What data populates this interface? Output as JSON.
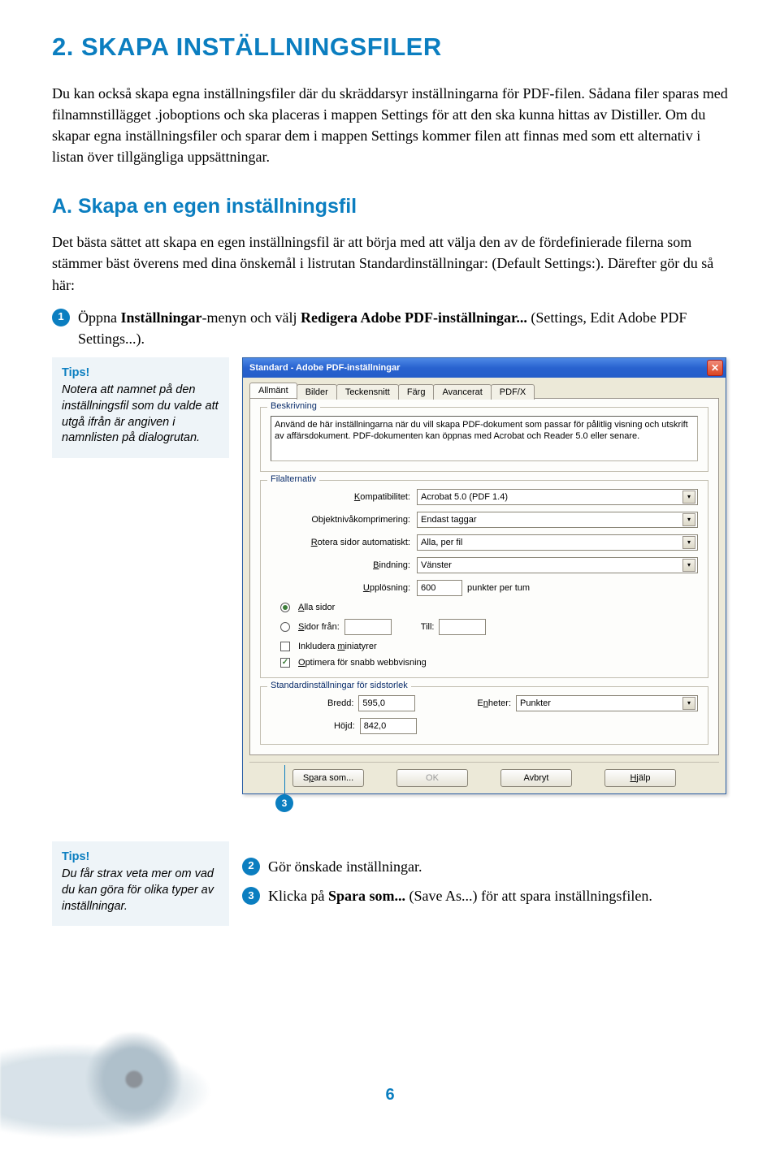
{
  "chapter_title": "2. SKAPA INSTÄLLNINGSFILER",
  "intro": "Du kan också skapa egna inställningsfiler där du skräddarsyr inställningarna för PDF-filen. Sådana filer sparas med filnamnstillägget .joboptions och ska placeras i mappen Settings för att den ska kunna hittas av Distiller. Om du skapar egna inställningsfiler och sparar dem i mappen Settings kommer filen att finnas med som ett alternativ i listan över tillgängliga uppsättningar.",
  "section_a_title": "A. Skapa en egen inställningsfil",
  "section_a_body": "Det bästa sättet att skapa en egen inställningsfil är att börja med att välja den av de fördefinierade filerna som stämmer bäst överens med dina önskemål i listrutan Standardinställningar: (Default Settings:). Därefter gör du så här:",
  "steps": {
    "s1_a": "Öppna ",
    "s1_b": "Inställningar",
    "s1_c": "-menyn och välj ",
    "s1_d": "Redigera Adobe PDF-inställningar...",
    "s1_e": " (Settings, Edit Adobe PDF Settings...).",
    "s2": "Gör önskade inställningar.",
    "s3_a": "Klicka på ",
    "s3_b": "Spara som...",
    "s3_c": " (Save As...) för att spara inställningsfilen."
  },
  "tips1": {
    "title": "Tips!",
    "body": "Notera att namnet på den inställningsfil som du valde att utgå ifrån är angiven i namnlisten på dialogrutan."
  },
  "tips2": {
    "title": "Tips!",
    "body": "Du får strax veta mer om vad du kan göra för olika typer av inställningar."
  },
  "dialog": {
    "title": "Standard - Adobe PDF-inställningar",
    "tabs": [
      "Allmänt",
      "Bilder",
      "Teckensnitt",
      "Färg",
      "Avancerat",
      "PDF/X"
    ],
    "group_desc": "Beskrivning",
    "desc_text": "Använd de här inställningarna när du vill skapa PDF-dokument som passar för pålitlig visning och utskrift av affärsdokument. PDF-dokumenten kan öppnas med Acrobat och Reader 5.0 eller senare.",
    "group_file": "Filalternativ",
    "labels": {
      "compat": "Kompatibilitet:",
      "objcomp": "Objektnivåkomprimering:",
      "rotate": "Rotera sidor automatiskt:",
      "binding": "Bindning:",
      "resolution": "Upplösning:",
      "ppi_suffix": "punkter per tum",
      "all_pages": "Alla sidor",
      "pages_from": "Sidor från:",
      "till": "Till:",
      "thumbs": "Inkludera miniatyrer",
      "optimize": "Optimera för snabb webbvisning"
    },
    "values": {
      "compat": "Acrobat 5.0 (PDF 1.4)",
      "objcomp": "Endast taggar",
      "rotate": "Alla, per fil",
      "binding": "Vänster",
      "resolution": "600"
    },
    "group_page": "Standardinställningar för sidstorlek",
    "page": {
      "width_label": "Bredd:",
      "width": "595,0",
      "height_label": "Höjd:",
      "height": "842,0",
      "units_label": "Enheter:",
      "units": "Punkter"
    },
    "buttons": {
      "save": "Spara som...",
      "ok": "OK",
      "cancel": "Avbryt",
      "help": "Hjälp"
    }
  },
  "page_number": "6",
  "callout_number": "3"
}
